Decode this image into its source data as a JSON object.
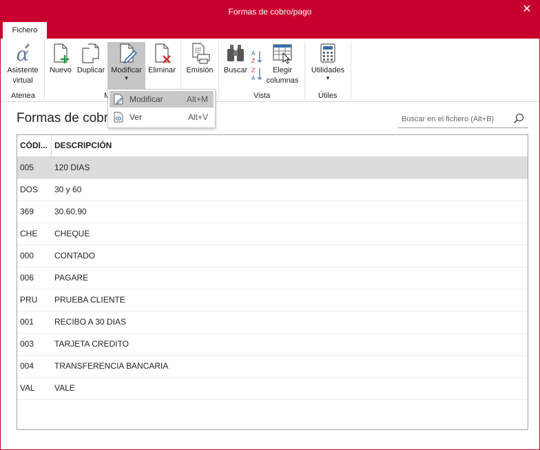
{
  "window": {
    "title": "Formas de cobro/pago",
    "close_glyph": "✕",
    "tab": "Fichero"
  },
  "ribbon": {
    "buttons": [
      {
        "id": "asistente",
        "label_line1": "Asistente",
        "label_line2": "virtual",
        "icon": "alpha-icon"
      },
      {
        "id": "nuevo",
        "label": "Nuevo",
        "icon": "new-document-icon"
      },
      {
        "id": "duplicar",
        "label": "Duplicar",
        "icon": "duplicate-icon"
      },
      {
        "id": "modificar",
        "label": "Modificar",
        "icon": "edit-document-icon",
        "dropdown_arrow": "▾"
      },
      {
        "id": "eliminar",
        "label": "Eliminar",
        "icon": "delete-document-icon"
      },
      {
        "id": "emision",
        "label": "Emisión",
        "icon": "print-icon"
      },
      {
        "id": "buscar",
        "label": "Buscar",
        "icon": "binoculars-icon"
      },
      {
        "id": "elegir",
        "label_line1": "Elegir",
        "label_line2": "columnas",
        "icon": "columns-icon"
      },
      {
        "id": "utilidades",
        "label": "Utilidades",
        "icon": "calculator-icon",
        "dropdown_arrow": "▾"
      }
    ],
    "groups": {
      "atenea": "Atenea",
      "mantenimiento_partial": "M",
      "vista": "Vista",
      "utiles": "Útiles"
    }
  },
  "dropdown": {
    "items": [
      {
        "label": "Modificar",
        "shortcut": "Alt+M",
        "icon": "edit-document-icon",
        "highlighted": true
      },
      {
        "label": "Ver",
        "shortcut": "Alt+V",
        "icon": "view-document-icon",
        "highlighted": false
      }
    ]
  },
  "main": {
    "title": "Formas de cobro",
    "search_placeholder": "Buscar en el fichero (Alt+B)"
  },
  "table": {
    "headers": {
      "code": "CÓDI...",
      "description": "DESCRIPCIÓN"
    },
    "rows": [
      {
        "code": "005",
        "description": "120 DIAS",
        "selected": true
      },
      {
        "code": "DOS",
        "description": "30 y 60"
      },
      {
        "code": "369",
        "description": "30.60.90"
      },
      {
        "code": "CHE",
        "description": "CHEQUE"
      },
      {
        "code": "000",
        "description": "CONTADO"
      },
      {
        "code": "006",
        "description": "PAGARE"
      },
      {
        "code": "PRU",
        "description": "PRUEBA CLIENTE"
      },
      {
        "code": "001",
        "description": "RECIBO A 30 DIAS"
      },
      {
        "code": "003",
        "description": "TARJETA CREDITO"
      },
      {
        "code": "004",
        "description": "TRANSFERENCIA BANCARIA"
      },
      {
        "code": "VAL",
        "description": "VALE"
      }
    ]
  },
  "colors": {
    "accent": "#c8002f",
    "selected_row": "#dcdcdc",
    "active_button": "#c6c6c6",
    "icon_blue": "#3c6ea8",
    "icon_green": "#1f9a3a",
    "icon_red": "#d32f2f"
  }
}
